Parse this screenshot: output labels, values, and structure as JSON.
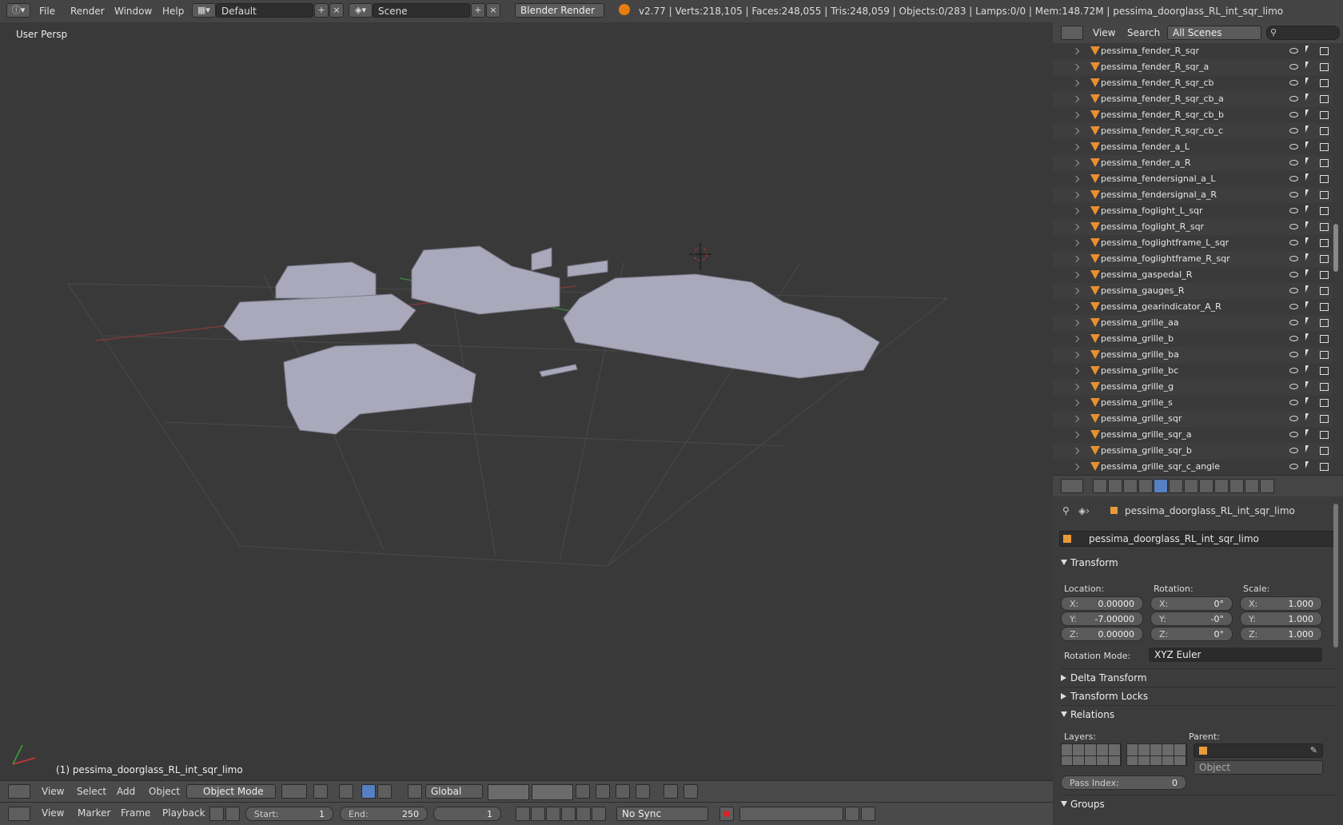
{
  "topbar": {
    "menus": [
      "File",
      "Render",
      "Window",
      "Help"
    ],
    "layout": "Default",
    "scene": "Scene",
    "engine": "Blender Render",
    "stats": "v2.77 | Verts:218,105 | Faces:248,055 | Tris:248,059 | Objects:0/283 | Lamps:0/0 | Mem:148.72M | pessima_doorglass_RL_int_sqr_limo"
  },
  "viewport": {
    "label": "User Persp",
    "active_object": "(1) pessima_doorglass_RL_int_sqr_limo"
  },
  "view3d_header": {
    "menus": [
      "View",
      "Select",
      "Add",
      "Object"
    ],
    "mode": "Object Mode",
    "orientation": "Global"
  },
  "timeline": {
    "menus": [
      "View",
      "Marker",
      "Frame",
      "Playback"
    ],
    "start_label": "Start:",
    "start": "1",
    "end_label": "End:",
    "end": "250",
    "current": "1",
    "sync": "No Sync"
  },
  "outliner": {
    "menus": [
      "View",
      "Search"
    ],
    "filter": "All Scenes",
    "items": [
      "pessima_fender_R_sqr",
      "pessima_fender_R_sqr_a",
      "pessima_fender_R_sqr_cb",
      "pessima_fender_R_sqr_cb_a",
      "pessima_fender_R_sqr_cb_b",
      "pessima_fender_R_sqr_cb_c",
      "pessima_fender_a_L",
      "pessima_fender_a_R",
      "pessima_fendersignal_a_L",
      "pessima_fendersignal_a_R",
      "pessima_foglight_L_sqr",
      "pessima_foglight_R_sqr",
      "pessima_foglightframe_L_sqr",
      "pessima_foglightframe_R_sqr",
      "pessima_gaspedal_R",
      "pessima_gauges_R",
      "pessima_gearindicator_A_R",
      "pessima_grille_aa",
      "pessima_grille_b",
      "pessima_grille_ba",
      "pessima_grille_bc",
      "pessima_grille_g",
      "pessima_grille_s",
      "pessima_grille_sqr",
      "pessima_grille_sqr_a",
      "pessima_grille_sqr_b",
      "pessima_grille_sqr_c_angle"
    ]
  },
  "properties": {
    "breadcrumb": "pessima_doorglass_RL_int_sqr_limo",
    "object_name": "pessima_doorglass_RL_int_sqr_limo",
    "transform": {
      "title": "Transform",
      "location_label": "Location:",
      "rotation_label": "Rotation:",
      "scale_label": "Scale:",
      "location": [
        {
          "k": "X:",
          "v": "0.00000"
        },
        {
          "k": "Y:",
          "v": "-7.00000"
        },
        {
          "k": "Z:",
          "v": "0.00000"
        }
      ],
      "rotation": [
        {
          "k": "X:",
          "v": "0°"
        },
        {
          "k": "Y:",
          "v": "-0°"
        },
        {
          "k": "Z:",
          "v": "0°"
        }
      ],
      "scale": [
        {
          "k": "X:",
          "v": "1.000"
        },
        {
          "k": "Y:",
          "v": "1.000"
        },
        {
          "k": "Z:",
          "v": "1.000"
        }
      ],
      "rotation_mode_label": "Rotation Mode:",
      "rotation_mode": "XYZ Euler"
    },
    "delta_transform": "Delta Transform",
    "transform_locks": "Transform Locks",
    "relations": {
      "title": "Relations",
      "layers_label": "Layers:",
      "parent_label": "Parent:",
      "parent_type": "Object",
      "pass_index_label": "Pass Index:",
      "pass_index": "0"
    },
    "groups": "Groups"
  }
}
